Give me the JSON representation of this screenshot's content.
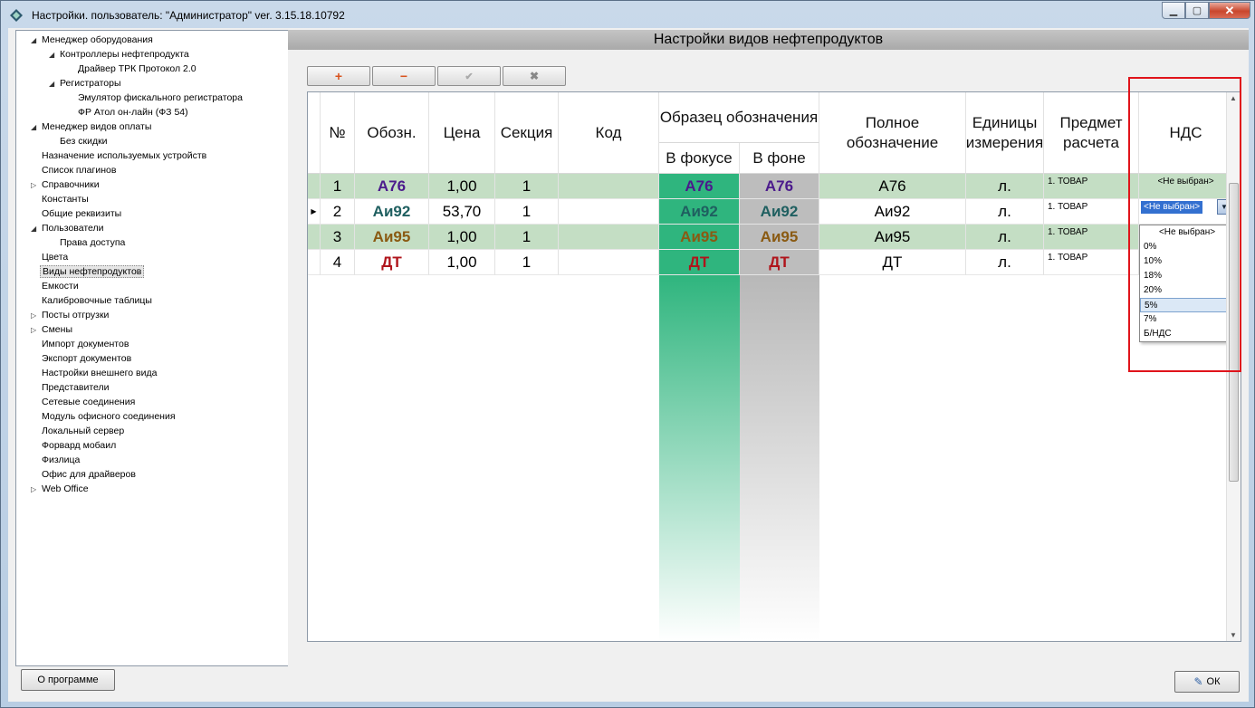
{
  "window": {
    "title": "Настройки. пользователь: \"Администратор\" ver. 3.15.18.10792"
  },
  "tree": {
    "items": [
      {
        "label": "Менеджер оборудования",
        "level": 0,
        "expander": "◢"
      },
      {
        "label": "Контроллеры нефтепродукта",
        "level": 1,
        "expander": "◢"
      },
      {
        "label": "Драйвер ТРК Протокол 2.0",
        "level": 2,
        "expander": ""
      },
      {
        "label": "Регистраторы",
        "level": 1,
        "expander": "◢"
      },
      {
        "label": "Эмулятор фискального регистратора",
        "level": 2,
        "expander": ""
      },
      {
        "label": "ФР Атол он-лайн (ФЗ 54)",
        "level": 2,
        "expander": ""
      },
      {
        "label": "Менеджер видов оплаты",
        "level": 0,
        "expander": "◢"
      },
      {
        "label": "Без скидки",
        "level": 1,
        "expander": ""
      },
      {
        "label": "Назначение используемых устройств",
        "level": 0,
        "expander": ""
      },
      {
        "label": "Список плагинов",
        "level": 0,
        "expander": ""
      },
      {
        "label": "Справочники",
        "level": 0,
        "expander": "▷"
      },
      {
        "label": "Константы",
        "level": 0,
        "expander": ""
      },
      {
        "label": "Общие реквизиты",
        "level": 0,
        "expander": ""
      },
      {
        "label": "Пользователи",
        "level": 0,
        "expander": "◢"
      },
      {
        "label": "Права доступа",
        "level": 1,
        "expander": ""
      },
      {
        "label": "Цвета",
        "level": 0,
        "expander": ""
      },
      {
        "label": "Виды нефтепродуктов",
        "level": 0,
        "expander": "",
        "selected": true
      },
      {
        "label": "Емкости",
        "level": 0,
        "expander": ""
      },
      {
        "label": "Калибровочные таблицы",
        "level": 0,
        "expander": ""
      },
      {
        "label": "Посты отгрузки",
        "level": 0,
        "expander": "▷"
      },
      {
        "label": "Смены",
        "level": 0,
        "expander": "▷"
      },
      {
        "label": "Импорт документов",
        "level": 0,
        "expander": ""
      },
      {
        "label": "Экспорт документов",
        "level": 0,
        "expander": ""
      },
      {
        "label": "Настройки внешнего вида",
        "level": 0,
        "expander": ""
      },
      {
        "label": "Представители",
        "level": 0,
        "expander": ""
      },
      {
        "label": "Сетевые соединения",
        "level": 0,
        "expander": ""
      },
      {
        "label": "Модуль офисного соединения",
        "level": 0,
        "expander": ""
      },
      {
        "label": "Локальный сервер",
        "level": 0,
        "expander": ""
      },
      {
        "label": "Форвард мобаил",
        "level": 0,
        "expander": ""
      },
      {
        "label": "Физлица",
        "level": 0,
        "expander": ""
      },
      {
        "label": "Офис для драйверов",
        "level": 0,
        "expander": ""
      },
      {
        "label": "Web Office",
        "level": 0,
        "expander": "▷"
      }
    ]
  },
  "panel": {
    "title": "Настройки видов нефтепродуктов",
    "toolbar": {
      "add": "+",
      "del": "−",
      "ok": "✔",
      "cancel": "✖"
    }
  },
  "grid": {
    "headers": {
      "num": "№",
      "oboz": "Обозн.",
      "price": "Цена",
      "section": "Секция",
      "code": "Код",
      "sample": "Образец обозначения",
      "focus": "В фокусе",
      "bg": "В фоне",
      "fullname": "Полное обозначение",
      "units": "Единицы измерения",
      "subject": "Предмет расчета",
      "vat": "НДС"
    },
    "rows": [
      {
        "num": "1",
        "oboz": "А76",
        "price": "1,00",
        "section": "1",
        "code": "",
        "focus": "А76",
        "bg": "А76",
        "fullname": "А76",
        "units": "л.",
        "subject": "1. ТОВАР",
        "vat": "<Не выбран>",
        "color": "#4b1a8c"
      },
      {
        "num": "2",
        "oboz": "Аи92",
        "price": "53,70",
        "section": "1",
        "code": "",
        "focus": "Аи92",
        "bg": "Аи92",
        "fullname": "Аи92",
        "units": "л.",
        "subject": "1. ТОВАР",
        "vat": "<Не выбран>",
        "color": "#1f5f60"
      },
      {
        "num": "3",
        "oboz": "Аи95",
        "price": "1,00",
        "section": "1",
        "code": "",
        "focus": "Аи95",
        "bg": "Аи95",
        "fullname": "Аи95",
        "units": "л.",
        "subject": "1. ТОВАР",
        "vat": "",
        "color": "#8a5a12"
      },
      {
        "num": "4",
        "oboz": "ДТ",
        "price": "1,00",
        "section": "1",
        "code": "",
        "focus": "ДТ",
        "bg": "ДТ",
        "fullname": "ДТ",
        "units": "л.",
        "subject": "1. ТОВАР",
        "vat": "",
        "color": "#b0141b"
      }
    ],
    "vat_options": [
      "<Не выбран>",
      "0%",
      "10%",
      "18%",
      "20%",
      "5%",
      "7%",
      "Б/НДС"
    ],
    "vat_highlighted": "5%"
  },
  "footer": {
    "about": "О программе",
    "ok": "ОК"
  },
  "colors": {
    "row_green": "#c4dec4",
    "focus_green": "#2fb57e",
    "bg_gray": "#bdbdbd",
    "highlight_box": "#e0141b"
  }
}
